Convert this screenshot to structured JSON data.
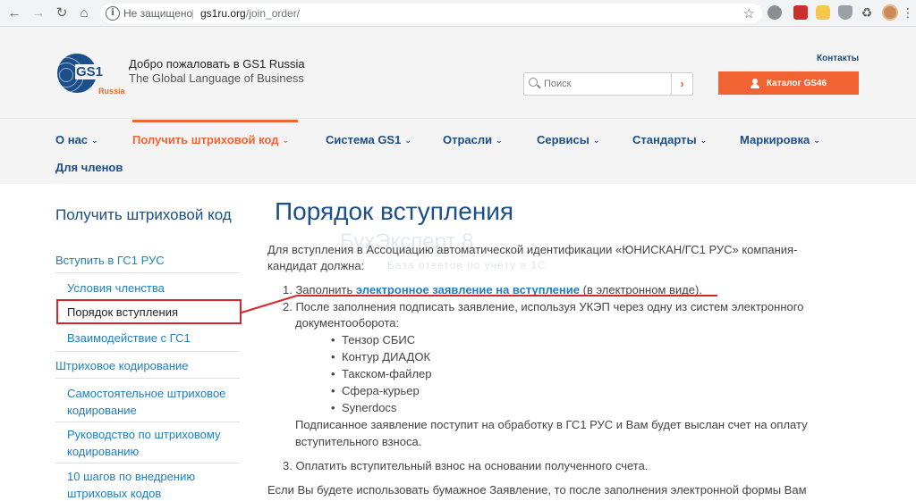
{
  "browser": {
    "security_text": "Не защищено",
    "separator": "|",
    "url_host": "gs1ru.org",
    "url_path": "/join_order/"
  },
  "header": {
    "logo_text": "GS1",
    "logo_sub": "Russia",
    "welcome": "Добро пожаловать в GS1 Russia",
    "tagline": "The Global Language of Business",
    "contacts": "Контакты",
    "search_placeholder": "Поиск",
    "search_go": "›",
    "catalog_label": "Каталог GS46"
  },
  "nav": {
    "items": [
      {
        "label": "О нас"
      },
      {
        "label": "Получить штриховой код"
      },
      {
        "label": "Система GS1"
      },
      {
        "label": "Отрасли"
      },
      {
        "label": "Сервисы"
      },
      {
        "label": "Стандарты"
      },
      {
        "label": "Маркировка"
      },
      {
        "label": "Для членов"
      }
    ]
  },
  "sidebar": {
    "title": "Получить штриховой код",
    "section1": "Вступить в ГС1 РУС",
    "items1": [
      "Условия членства",
      "Порядок вступления",
      "Взаимодействие с ГС1"
    ],
    "section2": "Штриховое кодирование",
    "items2": [
      "Самостоятельное штриховое кодирование",
      "Руководство по штриховому кодированию",
      "10 шагов по внедрению штриховых кодов"
    ]
  },
  "content": {
    "title": "Порядок вступления",
    "watermark": "БухЭксперт 8",
    "watermark_sub": "База ответов по учёту в 1С",
    "intro_line1": "Для вступления в Ассоциацию автоматической идентификации «ЮНИСКАН/ГС1 РУС» компания-",
    "intro_line2": "кандидат должна:",
    "step1_prefix": "1. Заполнить ",
    "step1_link": "электронное заявление на вступление",
    "step1_suffix": " (в электронном виде).",
    "step2_line1": "2. После заполнения подписать заявление, используя УКЭП через одну из систем электронного",
    "step2_line2": "документооборота:",
    "systems": [
      "Тензор СБИС",
      "Контур ДИАДОК",
      "Такском-файлер",
      "Сфера-курьер",
      "Synerdocs"
    ],
    "step2_note_line1": "Подписанное заявление поступит на обработку в ГС1 РУС и Вам будет выслан счет на оплату",
    "step2_note_line2": "вступительного взноса.",
    "step3": "3. Оплатить вступительный взнос на основании полученного счета.",
    "footer_line": "Если Вы будете использовать бумажное Заявление, то после заполнения электронной формы Вам"
  },
  "colors": {
    "brand_blue": "#1a4f8b",
    "link_blue": "#1c7fc4",
    "accent_orange": "#f26334",
    "annotation_red": "#d7262c"
  }
}
